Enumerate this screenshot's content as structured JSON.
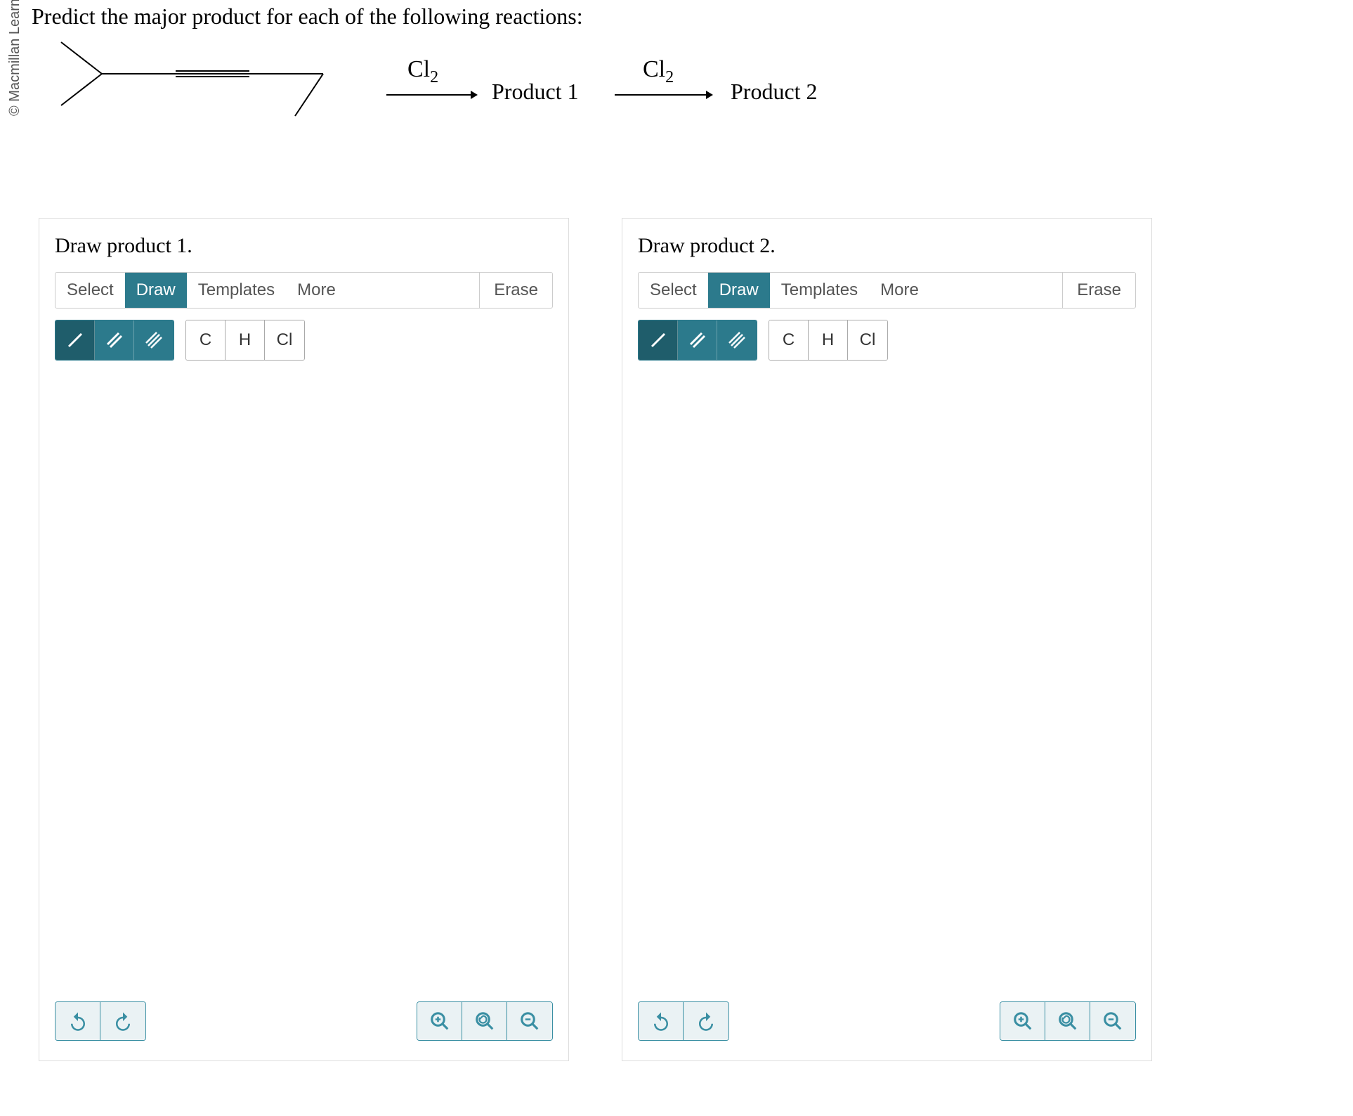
{
  "copyright": "© Macmillan Learning",
  "question": "Predict the major product for each of the following reactions:",
  "reaction": {
    "reagent1": "Cl",
    "reagent1_sub": "2",
    "product1_label": "Product 1",
    "reagent2": "Cl",
    "reagent2_sub": "2",
    "product2_label": "Product 2"
  },
  "panels": [
    {
      "title": "Draw product 1.",
      "tabs": [
        "Select",
        "Draw",
        "Templates",
        "More"
      ],
      "active_tab": "Draw",
      "erase": "Erase",
      "atoms": [
        "C",
        "H",
        "Cl"
      ]
    },
    {
      "title": "Draw product 2.",
      "tabs": [
        "Select",
        "Draw",
        "Templates",
        "More"
      ],
      "active_tab": "Draw",
      "erase": "Erase",
      "atoms": [
        "C",
        "H",
        "Cl"
      ]
    }
  ]
}
